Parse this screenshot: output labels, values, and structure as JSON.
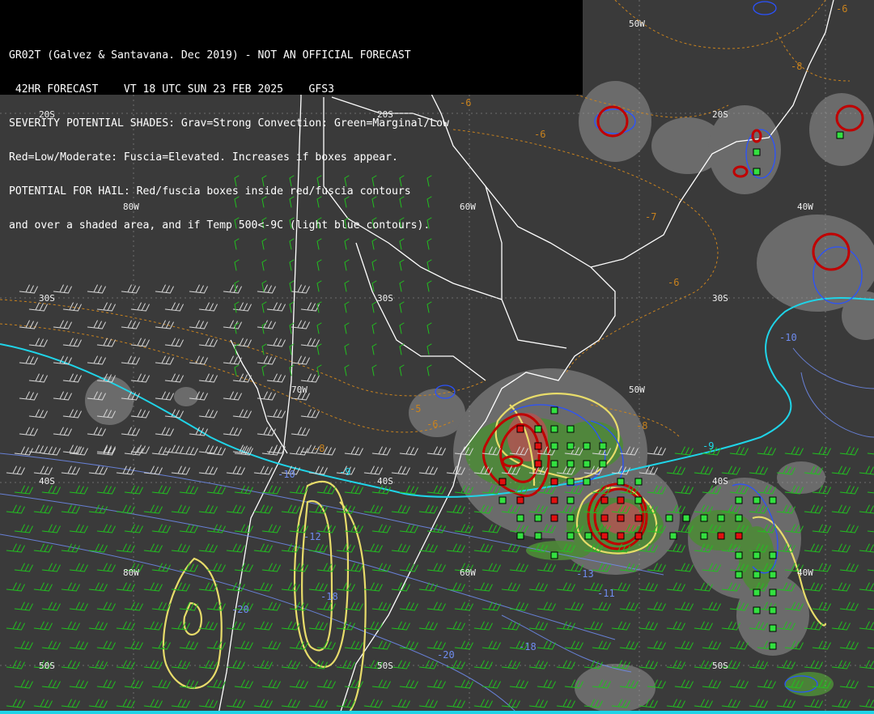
{
  "header": {
    "line1": "GR02T (Galvez & Santavana. Dec 2019) - NOT AN OFFICIAL FORECAST",
    "line2": " 42HR FORECAST    VT 18 UTC SUN 23 FEB 2025    GFS3",
    "line3": "SEVERITY POTENTIAL SHADES: Grav=Strong Convection: Green=Marginal/Low",
    "line4": "Red=Low/Moderate: Fuscia=Elevated. Increases if boxes appear.",
    "line5": "POTENTIAL FOR HAIL: Red/fuscia boxes inside red/fuscia contours",
    "line6": "and over a shaded area, and if Temp 500<-9C (light blue contours)."
  },
  "grid_labels": {
    "lat_20s_a": "20S",
    "lat_20s_b": "20S",
    "lat_20s_c": "20S",
    "lat_30s_a": "30S",
    "lat_30s_b": "30S",
    "lat_30s_c": "30S",
    "lat_40s_a": "40S",
    "lat_40s_b": "40S",
    "lat_40s_c": "40S",
    "lat_50s_a": "50S",
    "lat_50s_b": "50S",
    "lat_50s_c": "50S",
    "lon_50w_a": "50W",
    "lon_80w_a": "80W",
    "lon_60w_a": "60W",
    "lon_40w_a": "40W",
    "lon_70w_a": "70W",
    "lon_50w_b": "50W",
    "lon_80w_b": "80W",
    "lon_60w_b": "60W",
    "lon_40w_b": "40W"
  },
  "contour_labels": {
    "t_m6_a": "-6",
    "t_m8_a": "-8",
    "t_m6_b": "-6",
    "t_m6_c": "-6",
    "t_m7": "-7",
    "t_m6_d": "-6",
    "t_m5": "-5",
    "t_m6_e": "-6",
    "t_m8_b": "-8",
    "t_m8_c": "-8",
    "t_m9_a": "-9",
    "t_m9_b": "-9",
    "t_m10": "-10",
    "t_m10_b": "-10",
    "t_m12": "-12",
    "t_m13": "-13",
    "t_m18_a": "-18",
    "t_m18_b": "-18",
    "t_m20_a": "-20",
    "t_m20_b": "-20",
    "t_m11": "-11"
  },
  "colors": {
    "background": "#3a3a3a",
    "coast": "#ffffff",
    "strong_shade": "#7a7a7a",
    "marginal_shade": "#4f8a3a",
    "low_moderate_shade": "#b05050",
    "temp500_contour": "#1fd4e8",
    "orange_contour": "#c8821e",
    "yellow_contour": "#e8dc6a",
    "blue_contour": "#2a52ff",
    "red_contour": "#c00000",
    "wind_barb": "#22c020"
  }
}
